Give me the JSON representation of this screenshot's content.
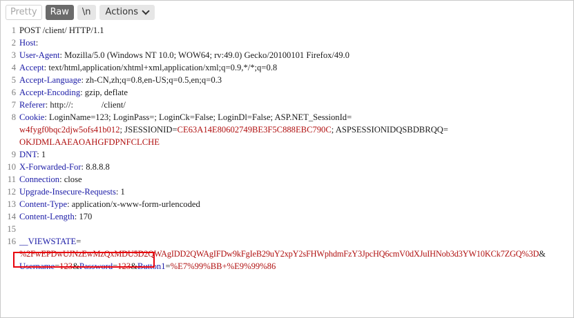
{
  "toolbar": {
    "pretty": "Pretty",
    "raw": "Raw",
    "newline": "\\n",
    "actions": "Actions"
  },
  "lines": {
    "n1": "1",
    "n2": "2",
    "n3": "3",
    "n4": "4",
    "n5": "5",
    "n6": "6",
    "n7": "7",
    "n8": "8",
    "n9": "9",
    "n10": "10",
    "n11": "11",
    "n12": "12",
    "n13": "13",
    "n14": "14",
    "n15": "15",
    "n16": "16",
    "l1": "POST /client/ HTTP/1.1",
    "l2_key": "Host",
    "l2_rest": ":",
    "l3_key": "User-Agent",
    "l3_rest": ": Mozilla/5.0 (Windows NT 10.0; WOW64; rv:49.0) Gecko/20100101 Firefox/49.0",
    "l4_key": "Accept",
    "l4_rest": ": text/html,application/xhtml+xml,application/xml;q=0.9,*/*;q=0.8",
    "l5_key": "Accept-Language",
    "l5_rest": ": zh-CN,zh;q=0.8,en-US;q=0.5,en;q=0.3",
    "l6_key": "Accept-Encoding",
    "l6_rest": ": gzip, deflate",
    "l7_key": "Referer",
    "l7_rest": ": http://:             /client/",
    "l8_key": "Cookie",
    "l8_c1": ": LoginName=123; LoginPass=; LoginCk=False; LoginDl=False; ASP.NET_SessionId=",
    "l8_r1": "w4fygf0bqc2djw5ofs41b012",
    "l8_c2": "; JSESSIONID=",
    "l8_r2": "CE63A14E80602749BE3F5C888EBC790C",
    "l8_c3": "; ASPSESSIONIDQSBDBRQQ=",
    "l8_r3": "OKJDMLAAEAOAHGFDPNFCLCHE",
    "l9_key": "DNT",
    "l9_rest": ": 1",
    "l10_key": "X-Forwarded-For",
    "l10_rest": ": 8.8.8.8",
    "l11_key": "Connection",
    "l11_rest": ": close",
    "l12_key": "Upgrade-Insecure-Requests",
    "l12_rest": ": 1",
    "l13_key": "Content-Type",
    "l13_rest": ": application/x-www-form-urlencoded",
    "l14_key": "Content-Length",
    "l14_rest": ": 170",
    "l16_key": "__VIEWSTATE",
    "l16_eq": "=",
    "l16_val": "%2FwEPDwUJNzEwMzQxMDU5D2QWAgIDD2QWAgIFDw9kFgIeB29uY2xpY2sFHWphdmFzY3JpcHQ6cmV0dXJuIHNob3d3YW10KCk7ZGQ%3D",
    "l16_amp1": "&",
    "l16_k2": "Username",
    "l16_e2": "=",
    "l16_v2": "123",
    "l16_amp2": "&",
    "l16_k3": "Password",
    "l16_e3": "=",
    "l16_v3": "123",
    "l16_amp3": "&",
    "l16_k4": "Button1",
    "l16_e4": "=",
    "l16_v4": "%E7%99%BB+%E9%99%86"
  },
  "colors": {
    "key": "#1a1aa6",
    "value_red": "#b01010",
    "highlight_box": "#e8000b",
    "raw_tab_bg": "#6b6b6b"
  }
}
